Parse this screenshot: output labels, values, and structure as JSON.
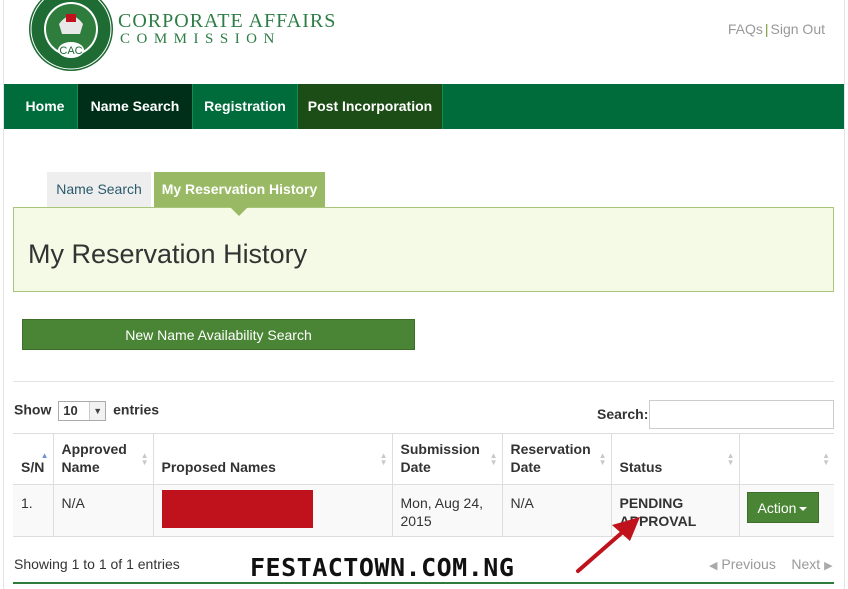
{
  "header": {
    "logo_line1": "CORPORATE AFFAIRS",
    "logo_line2": "COMMISSION",
    "seal_text_top": "CORPORATE AFFAIRS COMMISSION",
    "seal_abbr": "CAC",
    "faqs": "FAQs",
    "separator": "|",
    "sign_out": "Sign Out"
  },
  "nav": {
    "items": [
      {
        "label": "Home"
      },
      {
        "label": "Name Search"
      },
      {
        "label": "Registration"
      },
      {
        "label": "Post Incorporation"
      }
    ]
  },
  "tabs": {
    "name_search": "Name Search",
    "reservation_history": "My Reservation History"
  },
  "page_title": "My Reservation History",
  "new_search_button": "New Name Availability Search",
  "table_controls": {
    "show_label": "Show",
    "entries_value": "10",
    "entries_label": "entries",
    "search_label": "Search:"
  },
  "table": {
    "columns": [
      "S/N",
      "Approved Name",
      "Proposed Names",
      "Submission Date",
      "Reservation Date",
      "Status",
      ""
    ],
    "rows": [
      {
        "sn": "1.",
        "approved_name": "N/A",
        "proposed_names": "",
        "submission_date": "Mon, Aug 24, 2015",
        "reservation_date": "N/A",
        "status": "PENDING APPROVAL",
        "action": "Action"
      }
    ]
  },
  "footer": {
    "info": "Showing 1 to 1 of 1 entries",
    "previous": "Previous",
    "next": "Next"
  },
  "watermark": "FESTACTOWN.COM.NG",
  "colors": {
    "nav_green": "#006b3b",
    "button_green": "#4a8535",
    "tab_active": "#9ab965",
    "redaction": "#c0121c",
    "arrow_red": "#c0121c"
  }
}
